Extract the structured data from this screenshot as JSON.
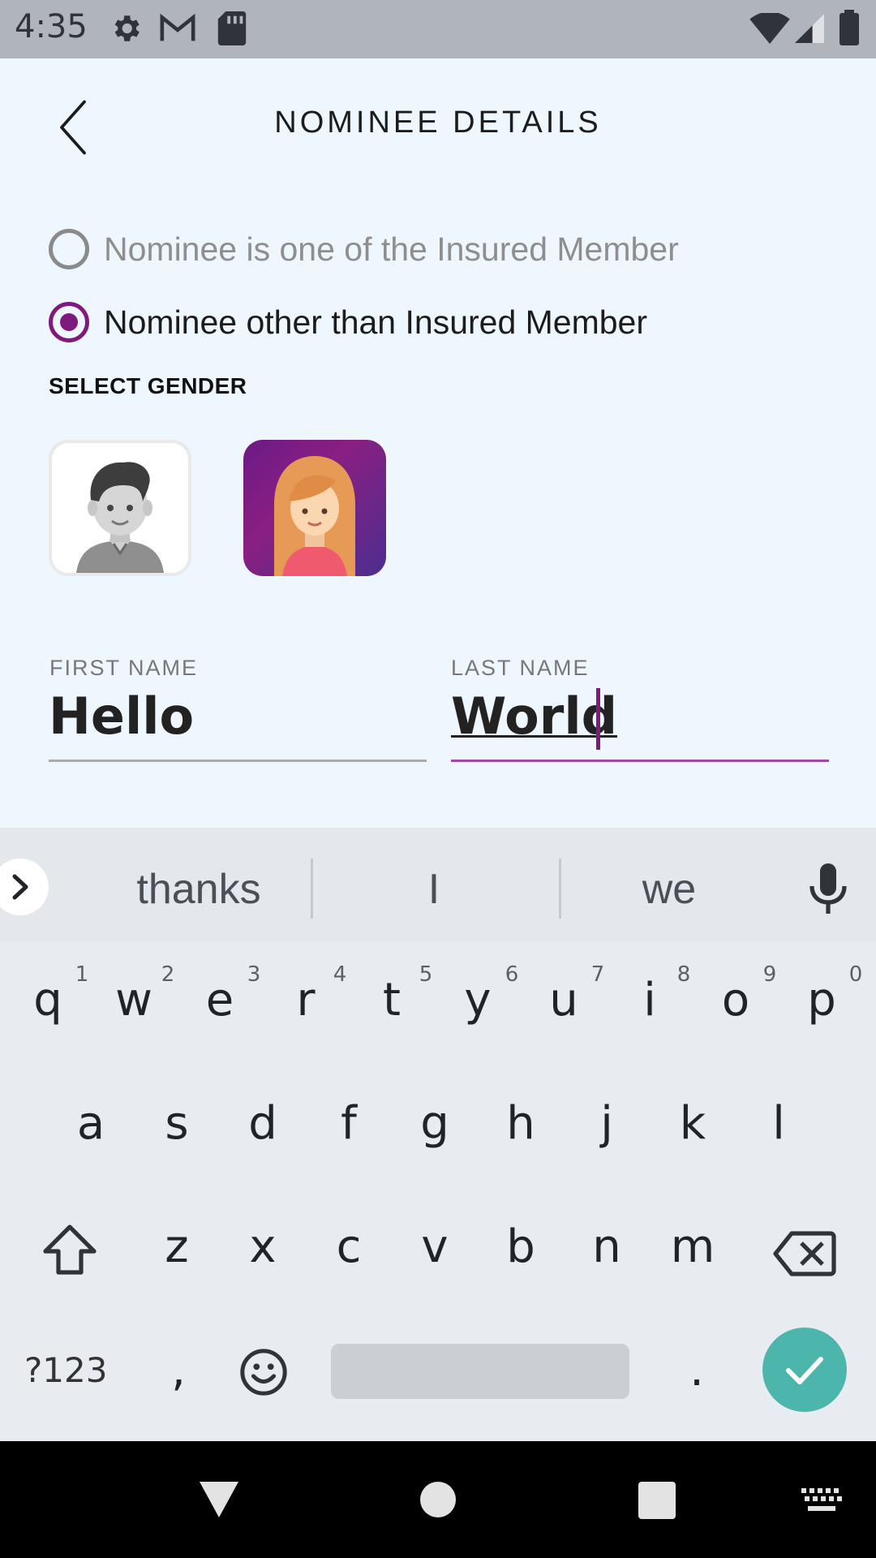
{
  "status_bar": {
    "time": "4:35",
    "left_icons": [
      "settings-icon",
      "gmail-icon",
      "sd-card-icon"
    ],
    "right_icons": [
      "wifi-icon",
      "signal-icon",
      "battery-icon"
    ]
  },
  "header": {
    "title": "NOMINEE DETAILS",
    "back_icon": "back-arrow-icon"
  },
  "nominee_options": [
    {
      "label": "Nominee is one of the Insured Member",
      "selected": false
    },
    {
      "label": "Nominee other than Insured Member",
      "selected": true
    }
  ],
  "gender": {
    "label": "SELECT GENDER",
    "options": [
      {
        "name": "male",
        "selected": false
      },
      {
        "name": "female",
        "selected": true
      }
    ]
  },
  "first_name": {
    "label": "FIRST NAME",
    "value": "Hello"
  },
  "last_name": {
    "label": "LAST NAME",
    "value": "World"
  },
  "keyboard": {
    "suggestions": [
      "thanks",
      "I",
      "we"
    ],
    "row1": [
      "q",
      "w",
      "e",
      "r",
      "t",
      "y",
      "u",
      "i",
      "o",
      "p"
    ],
    "row1_numbers": [
      "1",
      "2",
      "3",
      "4",
      "5",
      "6",
      "7",
      "8",
      "9",
      "0"
    ],
    "row2": [
      "a",
      "s",
      "d",
      "f",
      "g",
      "h",
      "j",
      "k",
      "l"
    ],
    "row3": [
      "z",
      "x",
      "c",
      "v",
      "b",
      "n",
      "m"
    ],
    "symbols_key": "?123",
    "comma_key": ",",
    "period_key": "."
  },
  "colors": {
    "accent": "#7e1a7e",
    "background": "#eef6fe",
    "enter_key": "#4db6ac"
  }
}
